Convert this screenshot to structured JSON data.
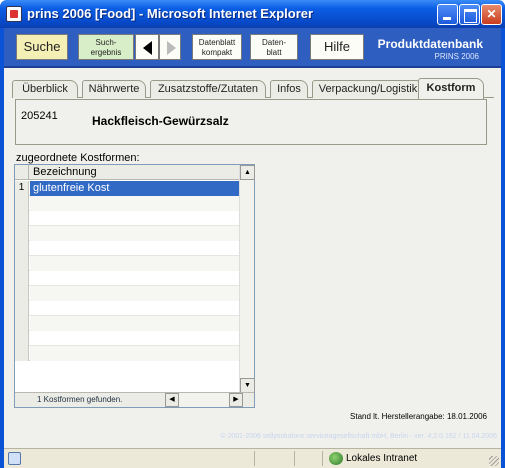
{
  "window": {
    "title": "prins 2006 [Food] - Microsoft Internet Explorer"
  },
  "toolbar": {
    "suche": "Suche",
    "suchergebnis_line1": "Such-",
    "suchergebnis_line2": "ergebnis",
    "datenblatt_kompakt_line1": "Datenblatt",
    "datenblatt_kompakt_line2": "kompakt",
    "datenblatt_line1": "Daten-",
    "datenblatt_line2": "blatt",
    "hilfe": "Hilfe",
    "brand_title": "Produktdatenbank",
    "brand_subtitle": "PRINS 2006"
  },
  "tabs": [
    {
      "label": "Überblick",
      "active": false
    },
    {
      "label": "Nährwerte",
      "active": false
    },
    {
      "label": "Zusatzstoffe/Zutaten",
      "active": false
    },
    {
      "label": "Infos",
      "active": false
    },
    {
      "label": "Verpackung/Logistik",
      "active": false
    },
    {
      "label": "Kostform",
      "active": true
    }
  ],
  "product": {
    "id": "205241",
    "name": "Hackfleisch-Gewürzsalz"
  },
  "list": {
    "label": "zugeordnete Kostformen:",
    "column_header": "Bezeichnung",
    "rows": [
      {
        "num": "1",
        "value": "glutenfreie Kost"
      }
    ],
    "footer": "1 Kostformen gefunden."
  },
  "stand_text": "Stand lt. Herstellerangabe: 18.01.2006",
  "copyright": "© 2001-2006 sellysolutions.serviceagesellschaft mbH, Berlin - ver. 4.2.0.162 / 11.04.2006",
  "statusbar": {
    "zone": "Lokales Intranet"
  },
  "colors": {
    "titlebar": "#0b5ee4",
    "toolbar": "#2e5ebf",
    "selection": "#316ac5"
  }
}
